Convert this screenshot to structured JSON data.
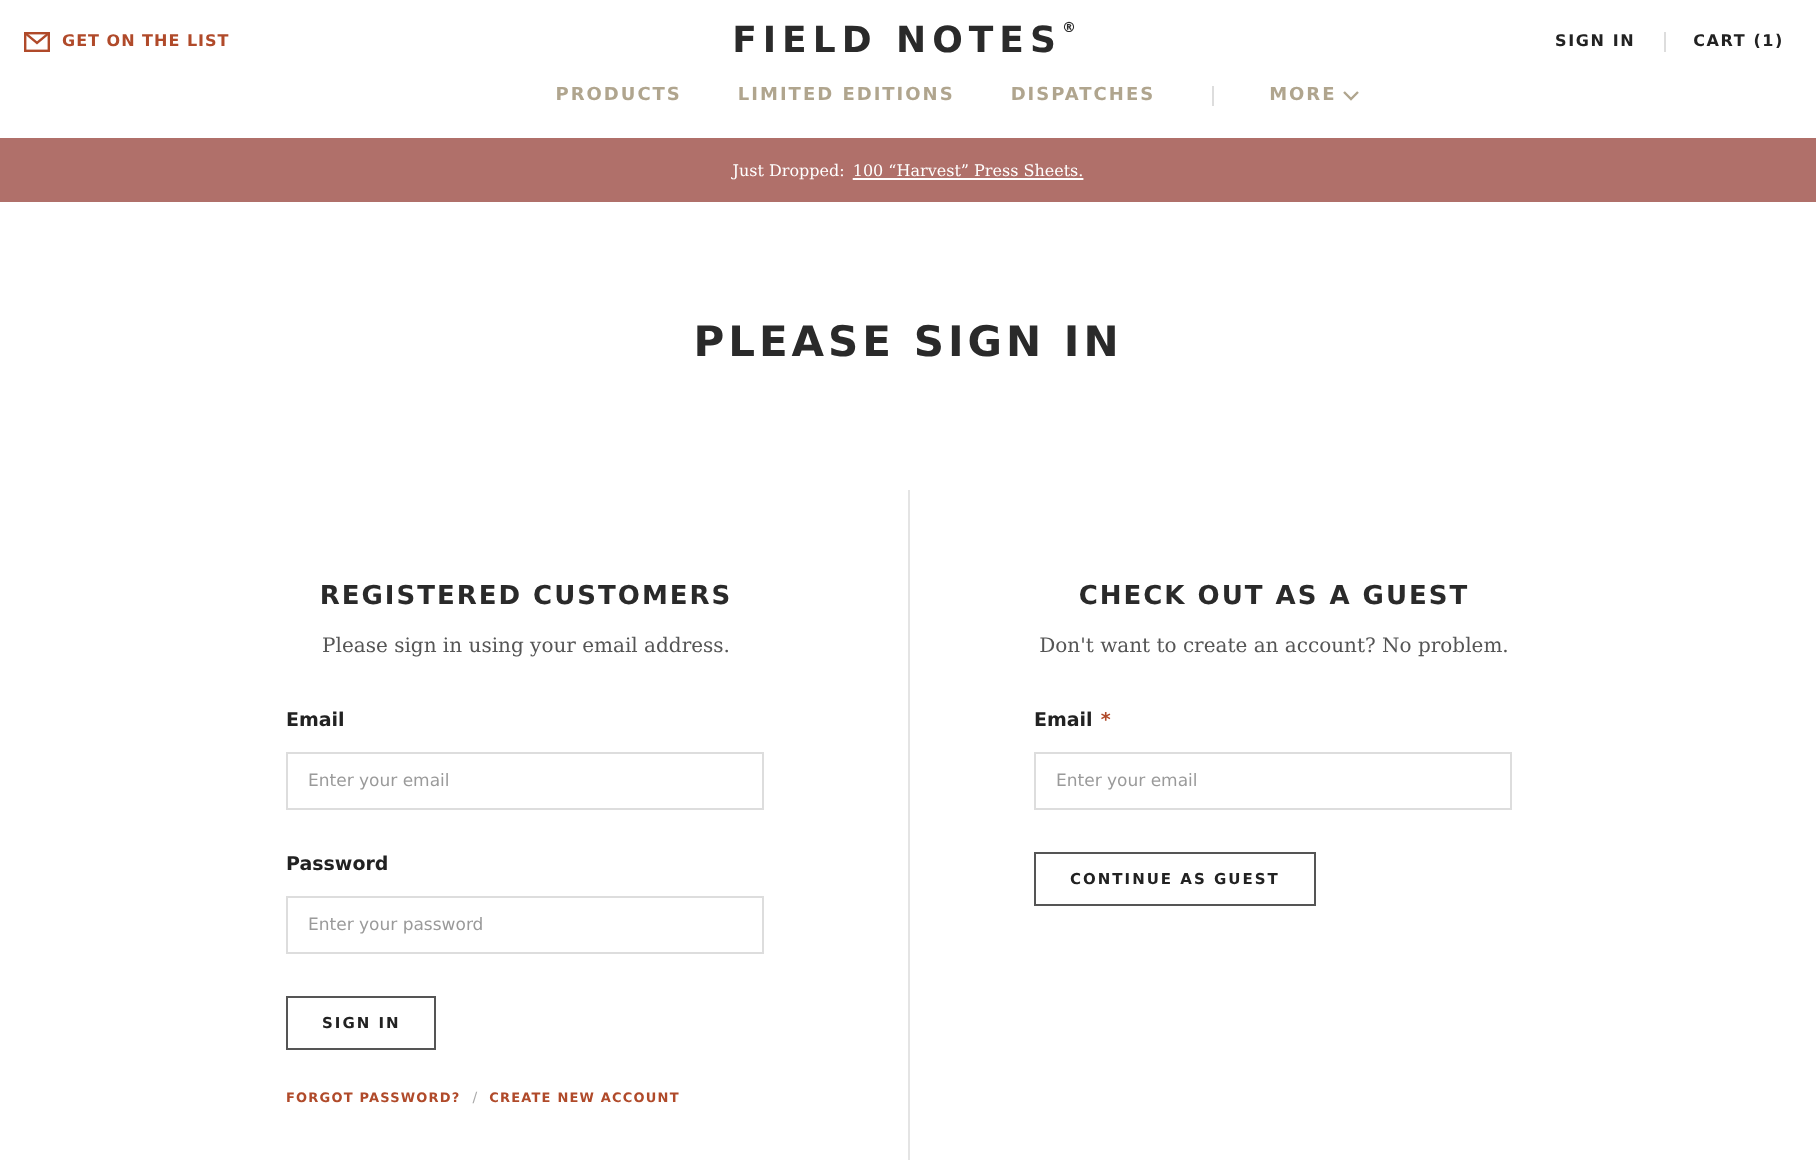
{
  "header": {
    "newsletter_link": "GET ON THE LIST",
    "logo": "FIELD NOTES",
    "logo_mark": "®",
    "account_links": [
      {
        "label": "SIGN IN"
      },
      {
        "label": "CART (1)"
      }
    ]
  },
  "nav": [
    {
      "label": "PRODUCTS",
      "kind": "link"
    },
    {
      "label": "LIMITED EDITIONS",
      "kind": "link"
    },
    {
      "label": "DISPATCHES",
      "kind": "link"
    },
    {
      "label": "MORE",
      "kind": "dropdown"
    }
  ],
  "banner": {
    "text": "Just Dropped:",
    "link": "100 “Harvest” Press Sheets."
  },
  "page_title": "PLEASE SIGN IN",
  "panels": [
    {
      "title": "REGISTERED CUSTOMERS",
      "subtitle": "Please sign in using your email address.",
      "fields": [
        {
          "label": "Email",
          "placeholder": "Enter your email"
        },
        {
          "label": "Password",
          "placeholder": "Enter your password"
        }
      ],
      "button": "SIGN IN",
      "links": [
        "FORGOT PASSWORD?",
        "CREATE NEW ACCOUNT"
      ],
      "link_separator": "/"
    },
    {
      "title": "CHECK OUT AS A GUEST",
      "subtitle": "Don't want to create an account? No problem.",
      "fields": [
        {
          "label": "Email",
          "placeholder": "Enter your email",
          "required_mark": "*"
        }
      ],
      "button": "CONTINUE AS GUEST"
    }
  ]
}
